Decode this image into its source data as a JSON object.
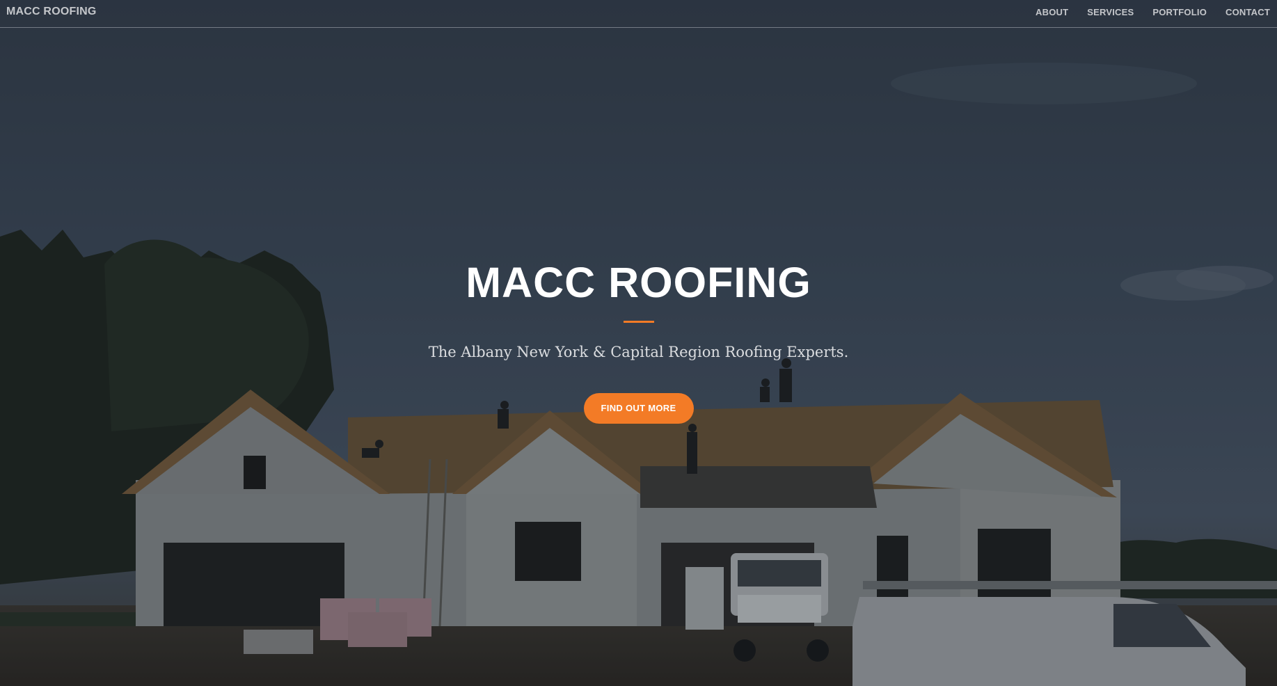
{
  "navbar": {
    "brand": "MACC ROOFING",
    "links": [
      {
        "label": "ABOUT"
      },
      {
        "label": "SERVICES"
      },
      {
        "label": "PORTFOLIO"
      },
      {
        "label": "CONTACT"
      }
    ]
  },
  "hero": {
    "title": "MACC ROOFING",
    "subtitle": "The Albany New York & Capital Region Roofing Experts.",
    "cta_label": "FIND OUT MORE",
    "background_image_description": ""
  },
  "colors": {
    "accent": "#f37b26",
    "sky": "#3a4657",
    "text": "#ffffff"
  }
}
